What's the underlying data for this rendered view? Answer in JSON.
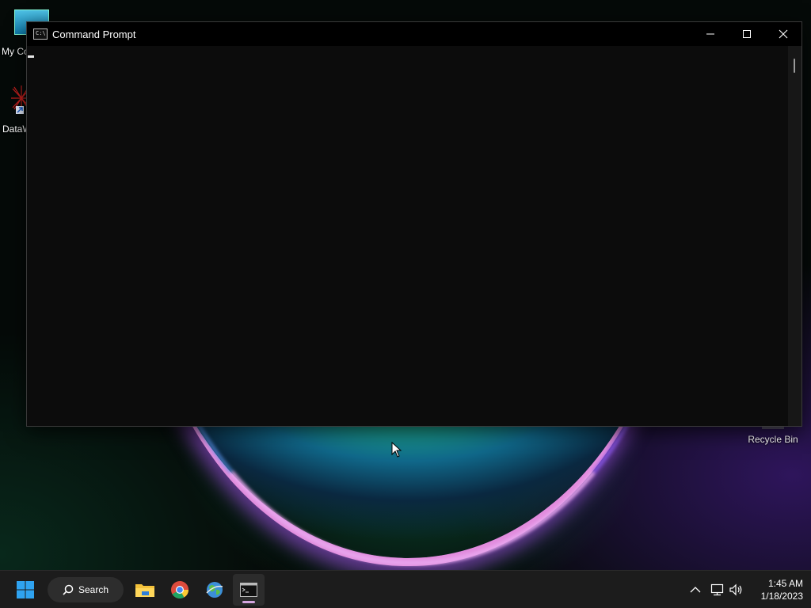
{
  "desktop": {
    "icons": [
      {
        "label": "My Co"
      },
      {
        "label": "DataW"
      },
      {
        "label": "Recycle Bin"
      }
    ]
  },
  "window": {
    "title": "Command Prompt",
    "icon_text": "C:\\"
  },
  "taskbar": {
    "search_label": "Search",
    "clock": {
      "time": "1:45 AM",
      "date": "1/18/2023"
    }
  },
  "colors": {
    "console_bg": "#0c0c0c",
    "titlebar_bg": "#000000",
    "taskbar_bg": "#1c1c1c",
    "start_blue": "#2fa3f0",
    "active_indicator": "#d5a6e0"
  }
}
